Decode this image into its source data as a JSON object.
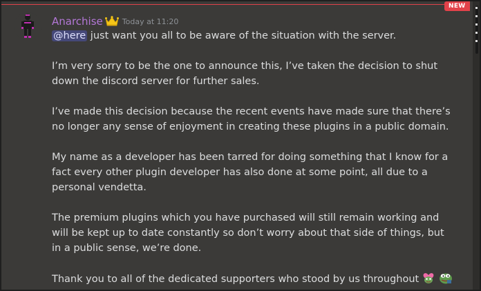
{
  "message": {
    "username": "Anarchise",
    "timestamp": "Today at 11:20",
    "mention": "@here",
    "intro": " just want you all to be aware of the situation with the server.",
    "paragraphs": [
      "I’m very sorry to be the one to announce this, I’ve taken the decision to shut down the discord server for further sales.",
      "I’ve made this decision because the recent events have made sure that there’s no longer any sense of enjoyment in creating these plugins in a public domain.",
      "My name as a developer has been tarred for doing something that I know for a fact every other plugin developer has also done at some point, all due to a personal vendetta.",
      "The premium plugins which you have purchased will still remain working and will be kept up to date constantly so don’t worry about that side of things, but in a public sense, we’re done."
    ],
    "closing": "Thank you to all of the dedicated supporters who stood by us throughout"
  },
  "divider": {
    "badge": "NEW"
  },
  "icons": {
    "avatar": "avatar-icon",
    "crown": "crown-icon",
    "emoji_1": "pepe-heart-emoji",
    "emoji_2": "pepe-emoji"
  },
  "colors": {
    "background": "#3b3a38",
    "username": "#b377d6",
    "new_divider": "#e2424a",
    "mention_bg": "#4a4c7a",
    "text": "#dcddde",
    "timestamp": "#8e9297"
  }
}
